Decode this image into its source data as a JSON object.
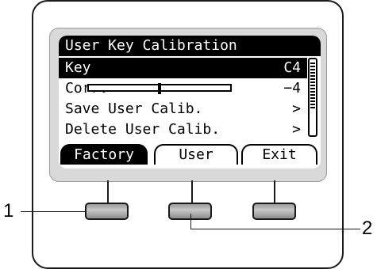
{
  "screen": {
    "title": "User Key Calibration",
    "rows": [
      {
        "label": "Key",
        "value": "C4"
      },
      {
        "label": "Corr.",
        "value": "−4"
      },
      {
        "label": "Save User Calib.",
        "value": ">"
      },
      {
        "label": "Delete User Calib.",
        "value": ">"
      }
    ],
    "corr_slider_fraction": 0.5,
    "softkeys": {
      "factory": "Factory",
      "user": "User",
      "exit": "Exit"
    }
  },
  "callouts": {
    "left": "1",
    "right": "2"
  },
  "colors": {
    "lcd_bg": "#d9d9d9",
    "ink": "#000000",
    "button": "#b0b0b0"
  }
}
